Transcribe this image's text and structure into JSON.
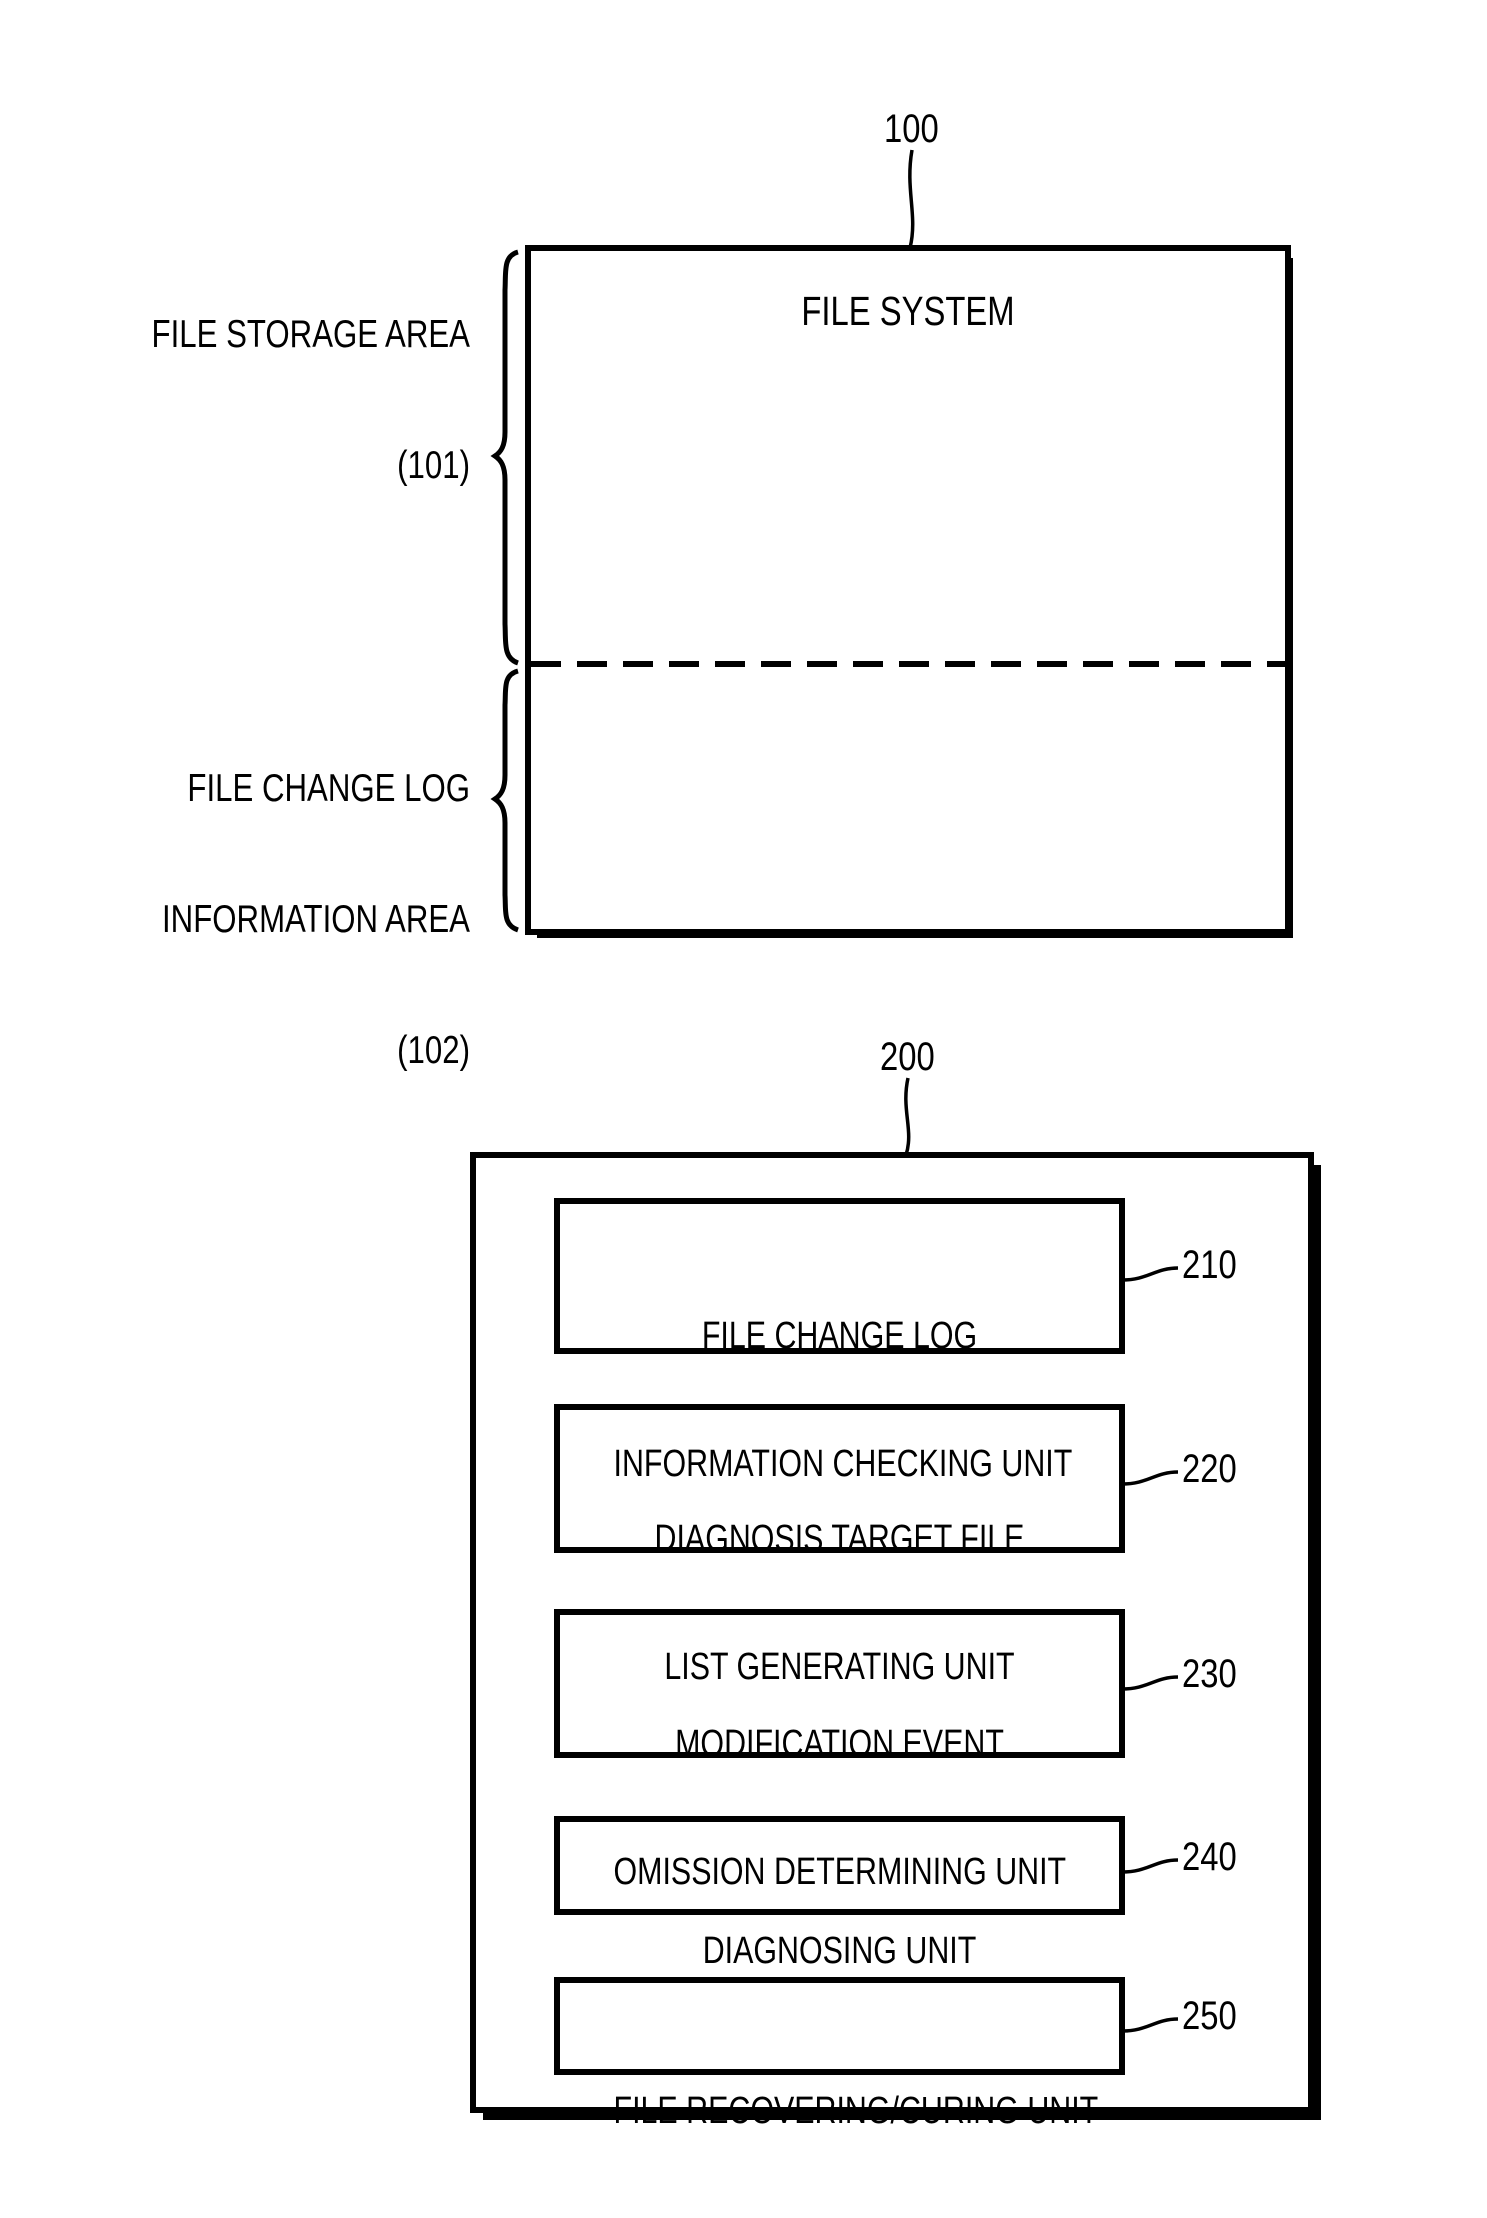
{
  "figure1": {
    "ref_number": "100",
    "box_title": "FILE SYSTEM",
    "areas": [
      {
        "label_line1": "FILE STORAGE AREA",
        "label_line2": "(101)",
        "label_line3": ""
      },
      {
        "label_line1": "FILE CHANGE LOG",
        "label_line2": "INFORMATION AREA",
        "label_line3": "(102)"
      }
    ]
  },
  "figure2": {
    "ref_number": "200",
    "units": [
      {
        "line1": "FILE CHANGE LOG",
        "line2": "INFORMATION CHECKING UNIT",
        "ref": "210"
      },
      {
        "line1": "DIAGNOSIS TARGET FILE",
        "line2": "LIST GENERATING UNIT",
        "ref": "220"
      },
      {
        "line1": "MODIFICATION EVENT",
        "line2": "OMISSION DETERMINING UNIT",
        "ref": "230"
      },
      {
        "line1": "DIAGNOSING UNIT",
        "line2": "",
        "ref": "240"
      },
      {
        "line1": "FILE RECOVERING/CURING UNIT",
        "line2": "",
        "ref": "250"
      }
    ]
  },
  "colors": {
    "ink": "#000000",
    "paper": "#ffffff"
  }
}
